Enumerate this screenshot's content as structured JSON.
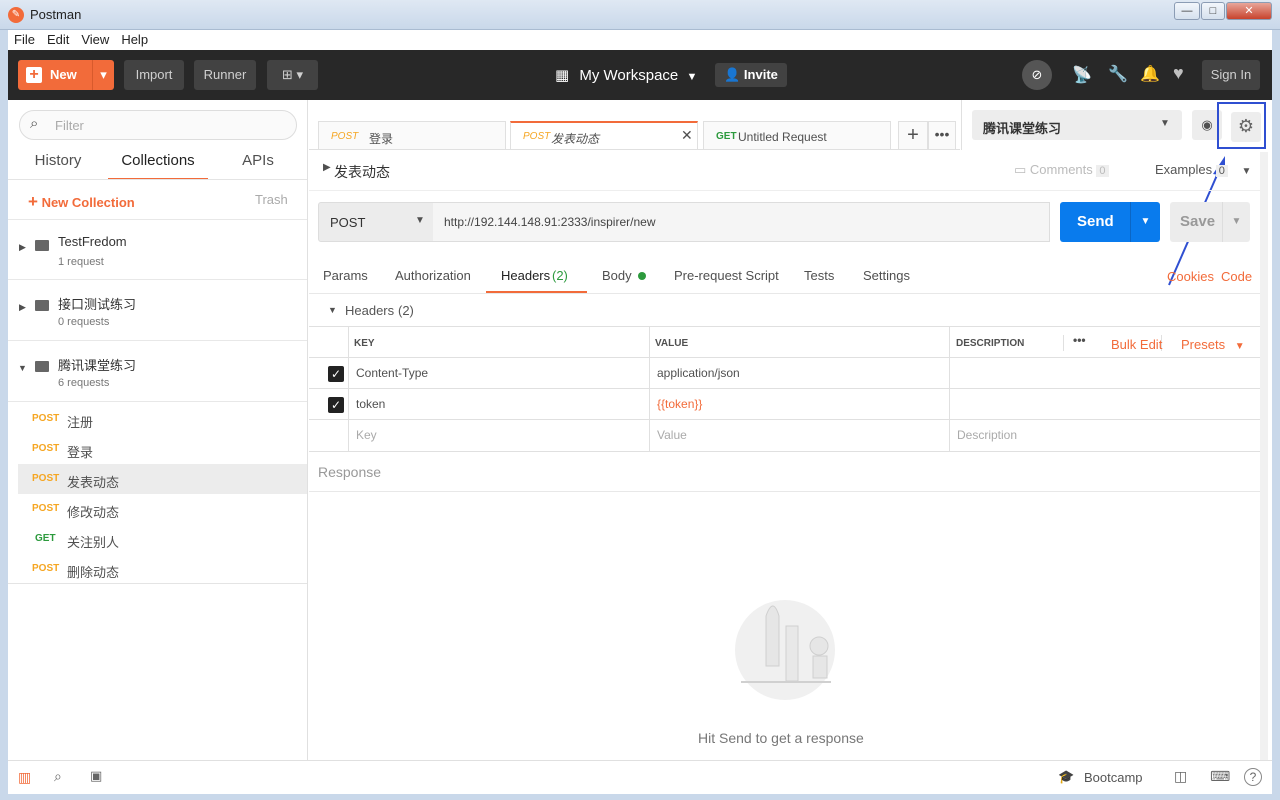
{
  "window": {
    "title": "Postman",
    "min": "—",
    "max": "□",
    "close": "✕"
  },
  "menu": [
    "File",
    "Edit",
    "View",
    "Help"
  ],
  "header": {
    "new_label": "New",
    "import_label": "Import",
    "runner_label": "Runner",
    "workspace_label": "My Workspace",
    "invite_label": "Invite",
    "signin_label": "Sign In"
  },
  "sidebar": {
    "search_placeholder": "Filter",
    "tabs": [
      "History",
      "Collections",
      "APIs"
    ],
    "new_collection_label": "New Collection",
    "trash_label": "Trash",
    "collections": [
      {
        "name": "TestFredom",
        "count": "1 request"
      },
      {
        "name": "接口测试练习",
        "count": "0 requests"
      },
      {
        "name": "腾讯课堂练习",
        "count": "6 requests"
      }
    ],
    "requests": [
      {
        "method": "POST",
        "name": "注册"
      },
      {
        "method": "POST",
        "name": "登录"
      },
      {
        "method": "POST",
        "name": "发表动态"
      },
      {
        "method": "POST",
        "name": "修改动态"
      },
      {
        "method": "GET",
        "name": "关注别人"
      },
      {
        "method": "POST",
        "name": "删除动态"
      }
    ]
  },
  "tabs": [
    {
      "method": "POST",
      "name": "登录"
    },
    {
      "method": "POST",
      "name": "发表动态"
    },
    {
      "method": "GET",
      "name": "Untitled Request"
    }
  ],
  "environment": {
    "selected": "腾讯课堂练习"
  },
  "request": {
    "title": "发表动态",
    "comments_label": "Comments",
    "comments_count": "0",
    "examples_label": "Examples",
    "examples_count": "0",
    "method": "POST",
    "url": "http://192.144.148.91:2333/inspirer/new",
    "send_label": "Send",
    "save_label": "Save",
    "sub_tabs": [
      "Params",
      "Authorization",
      "Headers",
      "Body",
      "Pre-request Script",
      "Tests",
      "Settings"
    ],
    "headers_count": "(2)",
    "cookies_label": "Cookies",
    "code_label": "Code",
    "headers_section_label": "Headers",
    "headers_section_count": "(2)",
    "columns": {
      "key": "KEY",
      "value": "VALUE",
      "description": "DESCRIPTION",
      "bulk_edit": "Bulk Edit",
      "presets": "Presets"
    },
    "rows": [
      {
        "key": "Content-Type",
        "value": "application/json"
      },
      {
        "key": "token",
        "value": "{{token}}"
      }
    ],
    "placeholder_row": {
      "key": "Key",
      "value": "Value",
      "description": "Description"
    }
  },
  "response": {
    "label": "Response",
    "empty_message": "Hit Send to get a response"
  },
  "footer": {
    "bootcamp_label": "Bootcamp"
  },
  "colors": {
    "accent": "#f26b3a",
    "send": "#097bed",
    "highlight": "#2f4fd1"
  }
}
